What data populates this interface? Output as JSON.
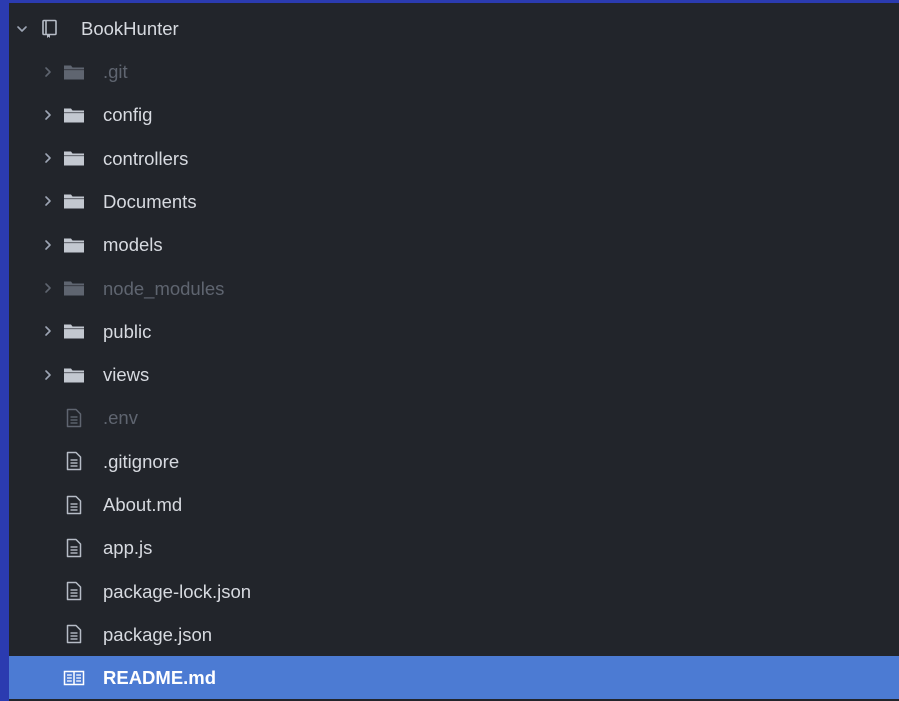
{
  "tree": {
    "root": {
      "label": "BookHunter",
      "expanded": true,
      "icon": "repo-icon"
    },
    "items": [
      {
        "type": "folder",
        "label": ".git",
        "ignored": true,
        "icon": "folder-icon"
      },
      {
        "type": "folder",
        "label": "config",
        "ignored": false,
        "icon": "folder-icon"
      },
      {
        "type": "folder",
        "label": "controllers",
        "ignored": false,
        "icon": "folder-icon"
      },
      {
        "type": "folder",
        "label": "Documents",
        "ignored": false,
        "icon": "folder-icon"
      },
      {
        "type": "folder",
        "label": "models",
        "ignored": false,
        "icon": "folder-icon"
      },
      {
        "type": "folder",
        "label": "node_modules",
        "ignored": true,
        "icon": "folder-icon"
      },
      {
        "type": "folder",
        "label": "public",
        "ignored": false,
        "icon": "folder-icon"
      },
      {
        "type": "folder",
        "label": "views",
        "ignored": false,
        "icon": "folder-icon"
      },
      {
        "type": "file",
        "label": ".env",
        "ignored": true,
        "icon": "file-text-icon"
      },
      {
        "type": "file",
        "label": ".gitignore",
        "ignored": false,
        "icon": "file-text-icon"
      },
      {
        "type": "file",
        "label": "About.md",
        "ignored": false,
        "icon": "file-text-icon"
      },
      {
        "type": "file",
        "label": "app.js",
        "ignored": false,
        "icon": "file-text-icon"
      },
      {
        "type": "file",
        "label": "package-lock.json",
        "ignored": false,
        "icon": "file-text-icon"
      },
      {
        "type": "file",
        "label": "package.json",
        "ignored": false,
        "icon": "file-text-icon"
      },
      {
        "type": "file",
        "label": "README.md",
        "ignored": false,
        "selected": true,
        "icon": "book-icon"
      }
    ]
  },
  "colors": {
    "window_border": "#2b3bb0",
    "panel_background": "#22252b",
    "text": "#d7dae0",
    "text_ignored": "#5f6570",
    "selection": "#4c7bd3",
    "selected_text": "#ffffff"
  }
}
